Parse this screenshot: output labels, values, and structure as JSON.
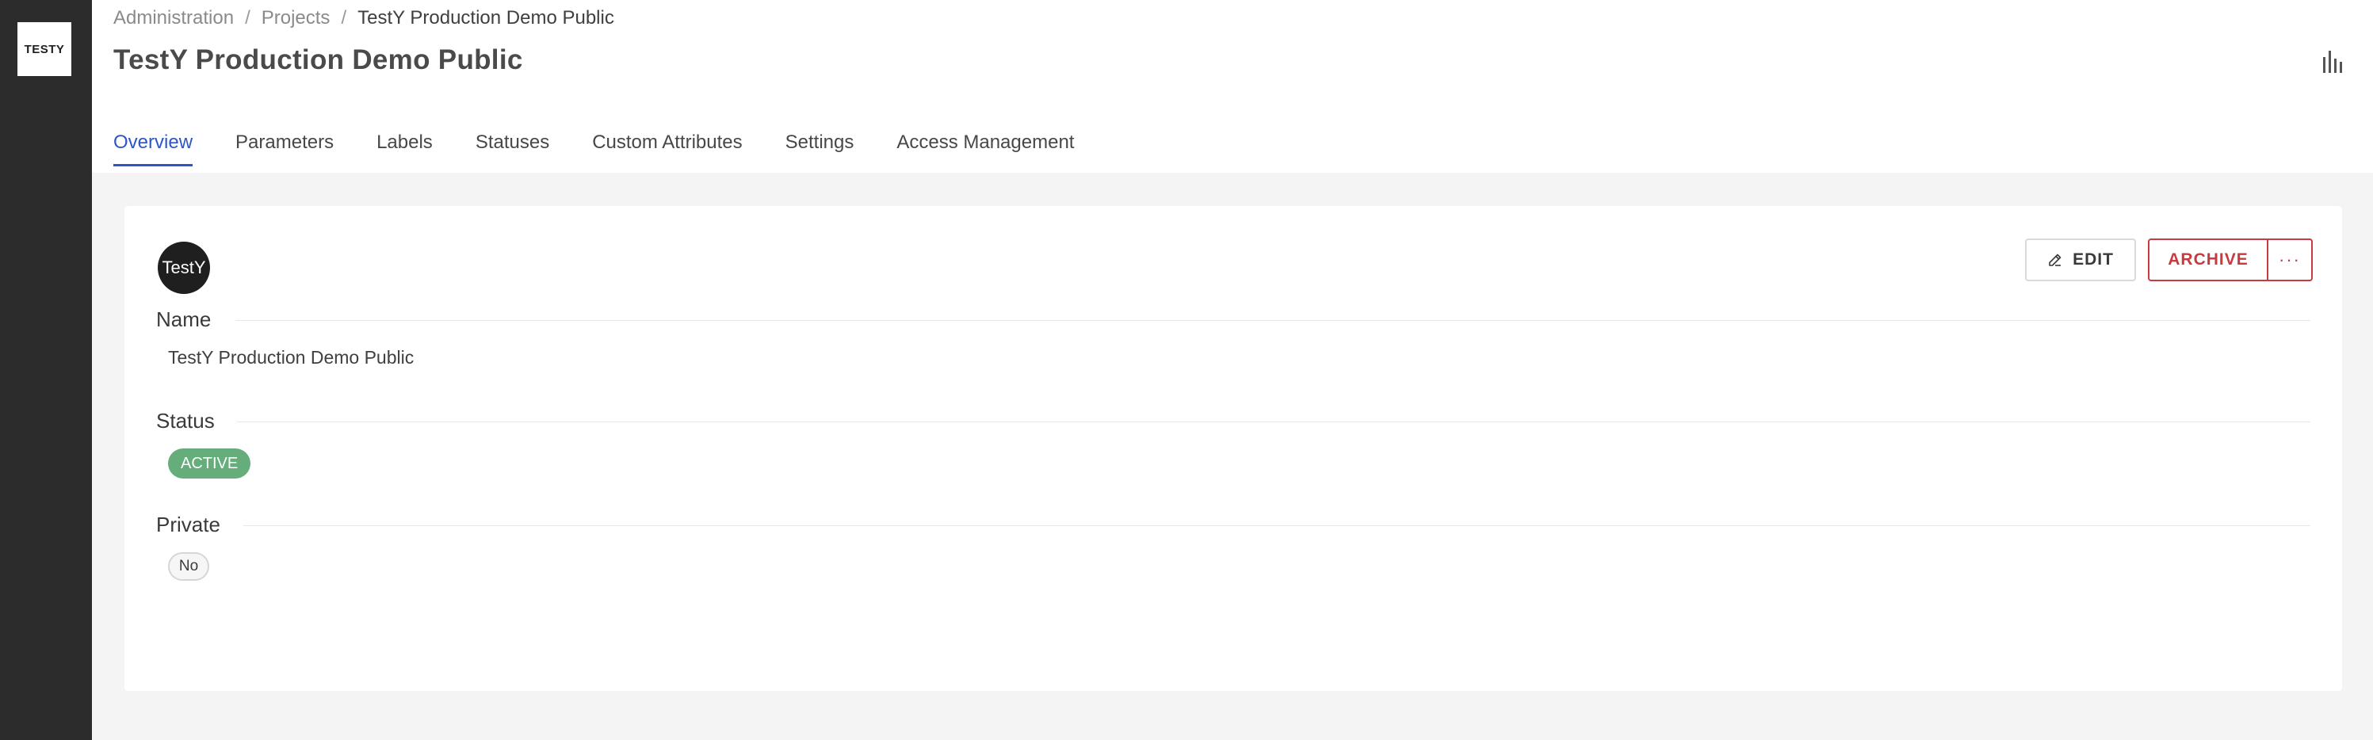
{
  "sidebar": {
    "logo_text": "TESTY"
  },
  "breadcrumb": {
    "items": [
      "Administration",
      "Projects"
    ],
    "separator": "/",
    "current": "TestY Production Demo Public"
  },
  "page": {
    "title": "TestY Production Demo Public",
    "stats_icon": "bar-chart-icon"
  },
  "tabs": [
    {
      "label": "Overview",
      "active": true
    },
    {
      "label": "Parameters",
      "active": false
    },
    {
      "label": "Labels",
      "active": false
    },
    {
      "label": "Statuses",
      "active": false
    },
    {
      "label": "Custom Attributes",
      "active": false
    },
    {
      "label": "Settings",
      "active": false
    },
    {
      "label": "Access Management",
      "active": false
    }
  ],
  "project": {
    "avatar_text": "TestY",
    "actions": {
      "edit_label": "EDIT",
      "archive_label": "ARCHIVE",
      "more_label": "···"
    },
    "fields": {
      "name_label": "Name",
      "name_value": "TestY Production Demo Public",
      "status_label": "Status",
      "status_value": "ACTIVE",
      "private_label": "Private",
      "private_value": "No"
    }
  },
  "colors": {
    "accent": "#2c56c8",
    "danger": "#c53b40",
    "status_active": "#65ad7b",
    "sidebar_bg": "#2c2c2c"
  }
}
